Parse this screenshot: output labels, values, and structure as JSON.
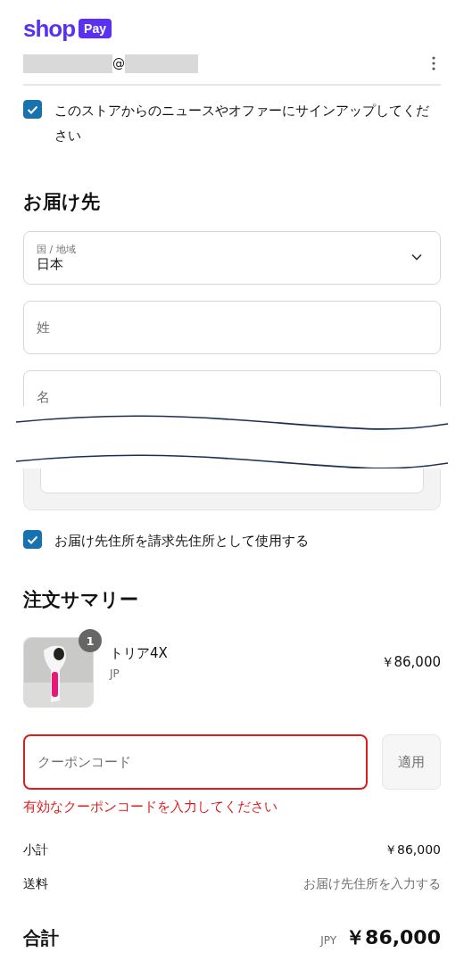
{
  "header": {
    "logo_word": "shop",
    "logo_badge": "Pay",
    "email_visible": "@"
  },
  "newsletter": {
    "label": "このストアからのニュースやオファーにサインアップしてください",
    "checked": true
  },
  "delivery": {
    "heading": "お届け先",
    "fields": [
      {
        "kind": "select",
        "label": "国 / 地域",
        "value": "日本"
      },
      {
        "kind": "text",
        "placeholder": "姓"
      },
      {
        "kind": "text",
        "placeholder": "名"
      }
    ]
  },
  "billing_same": {
    "label": "お届け先住所を請求先住所として使用する",
    "checked": true
  },
  "summary": {
    "heading": "注文サマリー",
    "items": [
      {
        "name": "トリア4X",
        "variant": "JP",
        "price": "￥86,000",
        "quantity": "1"
      }
    ],
    "coupon": {
      "placeholder": "クーポンコード",
      "button": "適用",
      "error": "有効なクーポンコードを入力してください",
      "invalid": true
    },
    "lines": [
      {
        "label": "小計",
        "value": "￥86,000",
        "muted": false
      },
      {
        "label": "送料",
        "value": "お届け先住所を入力する",
        "muted": true
      }
    ],
    "total": {
      "label": "合計",
      "currency": "JPY",
      "value": "￥86,000"
    }
  }
}
